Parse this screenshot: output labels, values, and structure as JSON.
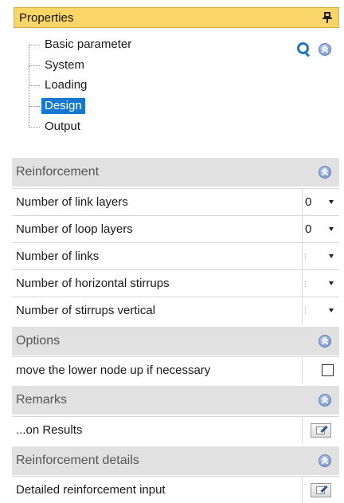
{
  "panel": {
    "title": "Properties"
  },
  "tree": {
    "items": [
      {
        "label": "Basic parameter"
      },
      {
        "label": "System"
      },
      {
        "label": "Loading"
      },
      {
        "label": "Design",
        "selected": true
      },
      {
        "label": "Output"
      }
    ]
  },
  "sections": {
    "reinforcement": {
      "title": "Reinforcement",
      "rows": [
        {
          "label": "Number of link layers",
          "value": "0"
        },
        {
          "label": "Number of loop layers",
          "value": "0"
        },
        {
          "label": "Number of links",
          "value": ""
        },
        {
          "label": "Number of horizontal stirrups",
          "value": ""
        },
        {
          "label": "Number of stirrups vertical",
          "value": ""
        }
      ]
    },
    "options": {
      "title": "Options",
      "rows": [
        {
          "label": "move the lower node up if necessary",
          "checked": false
        }
      ]
    },
    "remarks": {
      "title": "Remarks",
      "rows": [
        {
          "label": "...on Results"
        }
      ]
    },
    "reinforcement_details": {
      "title": "Reinforcement details",
      "rows": [
        {
          "label": "Detailed reinforcement input"
        }
      ]
    }
  },
  "icons": {
    "pin": "pin-icon",
    "search": "search-icon",
    "collapse": "collapse-icon",
    "dropdown": "chevron-down-icon",
    "edit": "edit-icon"
  },
  "colors": {
    "header_bg": "#fbd567",
    "selected_bg": "#1478d2",
    "section_bg": "#e1e1e1",
    "collapse_icon": "#6e8ec6"
  }
}
